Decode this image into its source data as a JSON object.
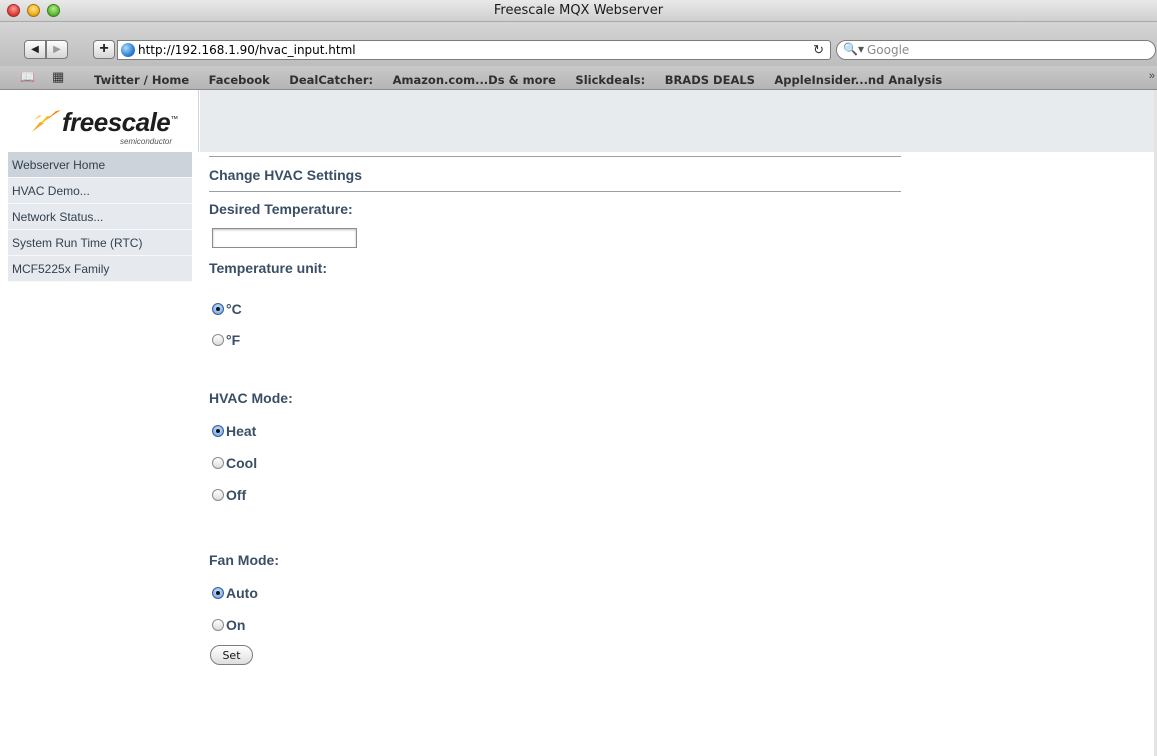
{
  "window": {
    "title": "Freescale MQX Webserver"
  },
  "toolbar": {
    "back_icon": "back-arrow-icon",
    "forward_icon": "forward-arrow-icon",
    "add_icon": "plus-icon",
    "url": "http://192.168.1.90/hvac_input.html",
    "reload_icon": "reload-icon",
    "search_placeholder": "Google"
  },
  "bookmarks": {
    "items": [
      "Twitter / Home",
      "Facebook",
      "DealCatcher:",
      "Amazon.com...Ds & more",
      "Slickdeals:",
      "BRADS DEALS",
      "AppleInsider...nd Analysis"
    ],
    "more": "»"
  },
  "logo": {
    "word": "freescale",
    "tm": "™",
    "sub": "semiconductor"
  },
  "sidebar": {
    "items": [
      {
        "label": "Webserver Home",
        "active": true
      },
      {
        "label": "HVAC Demo..."
      },
      {
        "label": "Network Status..."
      },
      {
        "label": "System Run Time (RTC)"
      },
      {
        "label": "MCF5225x Family"
      }
    ]
  },
  "form": {
    "heading": "Change HVAC Settings",
    "desired_temp_label": "Desired Temperature:",
    "desired_temp_value": "",
    "unit_label": "Temperature unit:",
    "unit_options": [
      {
        "label": "°C",
        "checked": true
      },
      {
        "label": "°F",
        "checked": false
      }
    ],
    "mode_label": "HVAC Mode:",
    "mode_options": [
      {
        "label": "Heat",
        "checked": true
      },
      {
        "label": "Cool",
        "checked": false
      },
      {
        "label": "Off",
        "checked": false
      }
    ],
    "fan_label": "Fan Mode:",
    "fan_options": [
      {
        "label": "Auto",
        "checked": true
      },
      {
        "label": "On",
        "checked": false
      }
    ],
    "submit_label": "Set"
  }
}
